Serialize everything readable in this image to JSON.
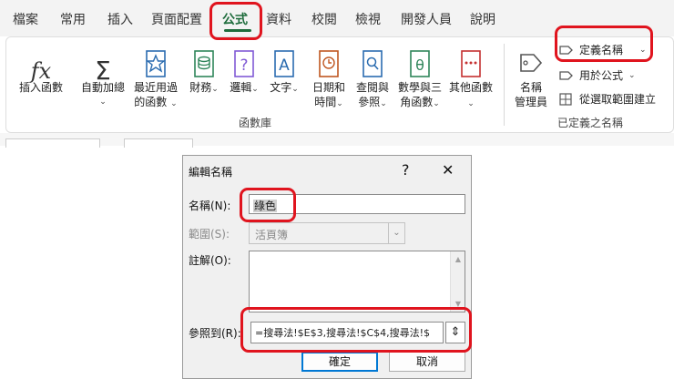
{
  "tabs": [
    "檔案",
    "常用",
    "插入",
    "頁面配置",
    "公式",
    "資料",
    "校閱",
    "檢視",
    "開發人員",
    "說明"
  ],
  "ribbon": {
    "insert_function": "插入函數",
    "autosum": [
      "自動加總"
    ],
    "recent": [
      "最近用過",
      "的函數"
    ],
    "financial": [
      "財務"
    ],
    "logical": [
      "邏輯"
    ],
    "text": [
      "文字"
    ],
    "datetime": [
      "日期和",
      "時間"
    ],
    "lookup": [
      "查閱與",
      "參照"
    ],
    "math": [
      "數學與三",
      "角函數"
    ],
    "more": [
      "其他函數"
    ],
    "group_library": "函數庫",
    "name_manager": [
      "名稱",
      "管理員"
    ],
    "define_name": "定義名稱",
    "use_in_formula": "用於公式",
    "create_from_selection": "從選取範圍建立",
    "group_defined_names": "已定義之名稱"
  },
  "dialog": {
    "title": "編輯名稱",
    "help": "?",
    "close": "✕",
    "name_label": "名稱(N):",
    "name_value": "綠色",
    "scope_label": "範圍(S):",
    "scope_value": "活頁簿",
    "comment_label": "註解(O):",
    "comment_value": "",
    "refers_label": "參照到(R):",
    "refers_value": "=搜尋法!$E$3,搜尋法!$C$4,搜尋法!$",
    "ok": "確定",
    "cancel": "取消"
  },
  "colors": {
    "accent": "#1e6c3c",
    "highlight": "#e0141e"
  }
}
